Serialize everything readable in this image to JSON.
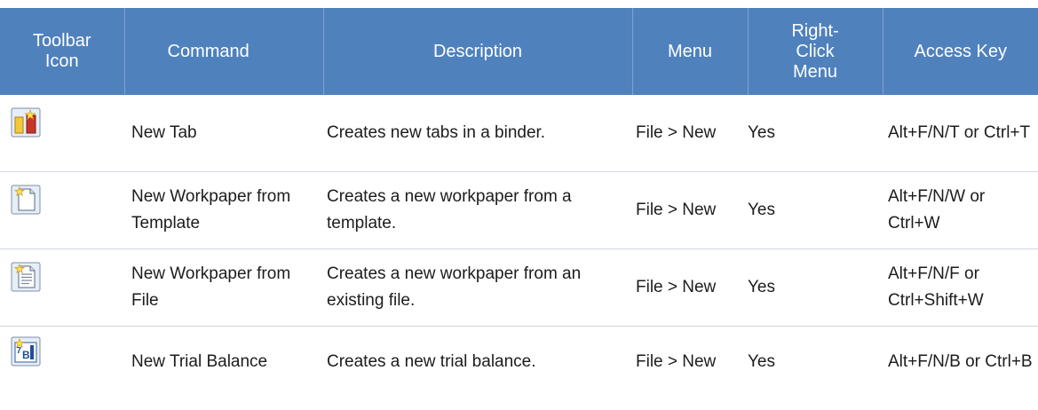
{
  "table": {
    "headers": {
      "icon": "Toolbar Icon",
      "command": "Command",
      "description": "Description",
      "menu": "Menu",
      "right_click": "Right-Click Menu",
      "access_key": "Access Key"
    },
    "header_color": "#4f81bd",
    "rows": [
      {
        "icon": "new-tab-icon",
        "command": "New Tab",
        "description": "Creates new tabs in a binder.",
        "menu": "File > New",
        "right_click": "Yes",
        "access_key": "Alt+F/N/T or Ctrl+T"
      },
      {
        "icon": "new-workpaper-from-template-icon",
        "command": "New Workpaper from Template",
        "description": "Creates a new workpaper from a template.",
        "menu": "File > New",
        "right_click": "Yes",
        "access_key": "Alt+F/N/W or Ctrl+W"
      },
      {
        "icon": "new-workpaper-from-file-icon",
        "command": "New Workpaper from File",
        "description": "Creates a new workpaper from an existing file.",
        "menu": "File > New",
        "right_click": "Yes",
        "access_key": "Alt+F/N/F or Ctrl+Shift+W"
      },
      {
        "icon": "new-trial-balance-icon",
        "command": "New Trial Balance",
        "description": "Creates a new trial balance.",
        "menu": "File > New",
        "right_click": "Yes",
        "access_key": "Alt+F/N/B or Ctrl+B"
      }
    ]
  }
}
